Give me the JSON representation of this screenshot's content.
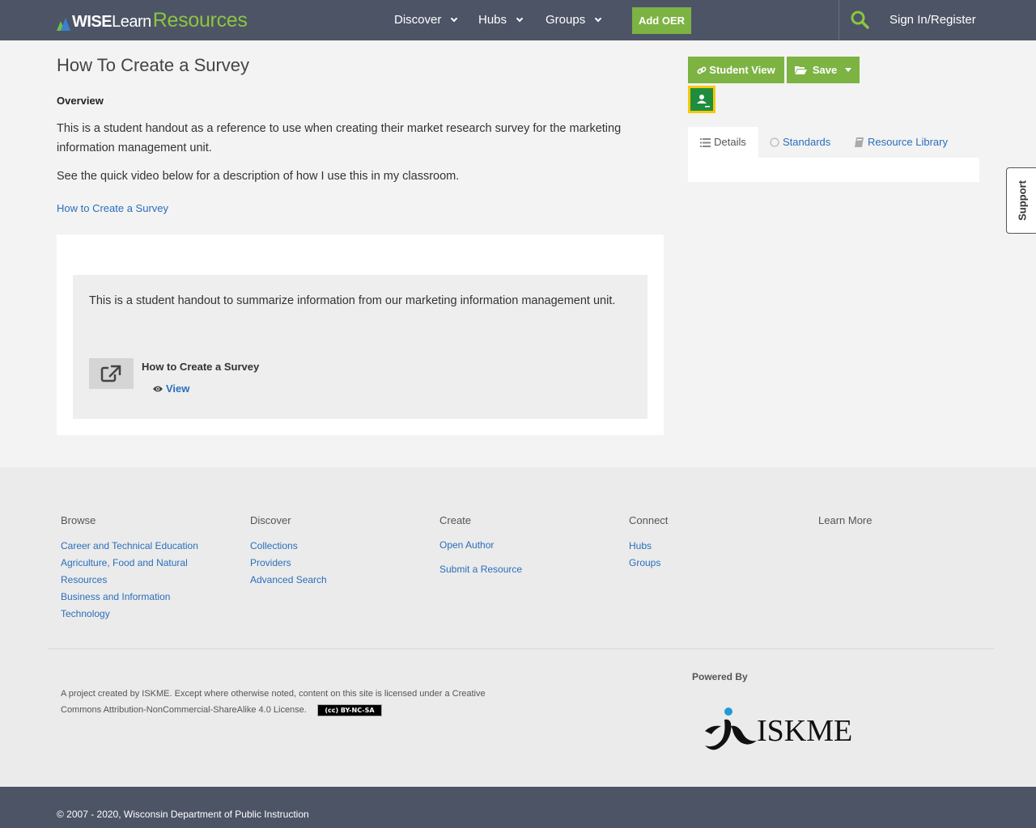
{
  "header": {
    "logo": {
      "wise": "WISE",
      "learn": "Learn",
      "resources": "Resources"
    },
    "nav": [
      {
        "label": "Discover"
      },
      {
        "label": "Hubs"
      },
      {
        "label": "Groups"
      }
    ],
    "add_oer": "Add OER",
    "sign_in": "Sign In/Register",
    "icons": {
      "search": "search-icon",
      "chevron": "chevron-down-icon"
    }
  },
  "main": {
    "title": "How To Create a Survey",
    "overview_heading": "Overview",
    "description_1": "This is a student handout as a reference to use when creating their market research survey for the marketing information management unit.",
    "description_2": "See the quick video below for a description of how I use this in my classroom.",
    "link": "How to Create a Survey",
    "card": {
      "text": "This is a student handout to summarize information from our marketing information management unit.",
      "resource_title": "How to Create a Survey",
      "view_label": "View"
    }
  },
  "sidebar": {
    "student_view": "Student View",
    "save": "Save",
    "tabs": [
      {
        "label": "Details",
        "icon": "list-icon",
        "active": true
      },
      {
        "label": "Standards",
        "icon": "circle-icon",
        "active": false
      },
      {
        "label": "Resource Library",
        "icon": "book-icon",
        "active": false
      }
    ]
  },
  "support_tab": "Support",
  "footer": {
    "columns": [
      {
        "heading": "Browse",
        "links": [
          "Career and Technical Education",
          "Agriculture, Food and Natural Resources",
          "Business and Information Technology"
        ]
      },
      {
        "heading": "Discover",
        "links": [
          "Collections",
          "Providers",
          "Advanced Search"
        ]
      },
      {
        "heading": "Create",
        "links": [
          "Open Author",
          "Submit a Resource"
        ]
      },
      {
        "heading": "Connect",
        "links": [
          "Hubs",
          "Groups"
        ]
      },
      {
        "heading": "Learn More",
        "links": []
      }
    ],
    "license_text": "A project created by ISKME. Except where otherwise noted, content on this site is licensed under a Creative Commons Attribution-NonCommercial-ShareAlike 4.0 License.",
    "cc_badge": "(cc) BY-NC-SA",
    "powered_by": "Powered By",
    "iskme": "ISKME",
    "copyright": "© 2007 - 2020, Wisconsin Department of Public Instruction"
  },
  "colors": {
    "header_bg": "#4d5466",
    "accent_green": "#7cb342",
    "link_blue": "#2a6ebb",
    "page_bg": "#f3f3f3"
  }
}
